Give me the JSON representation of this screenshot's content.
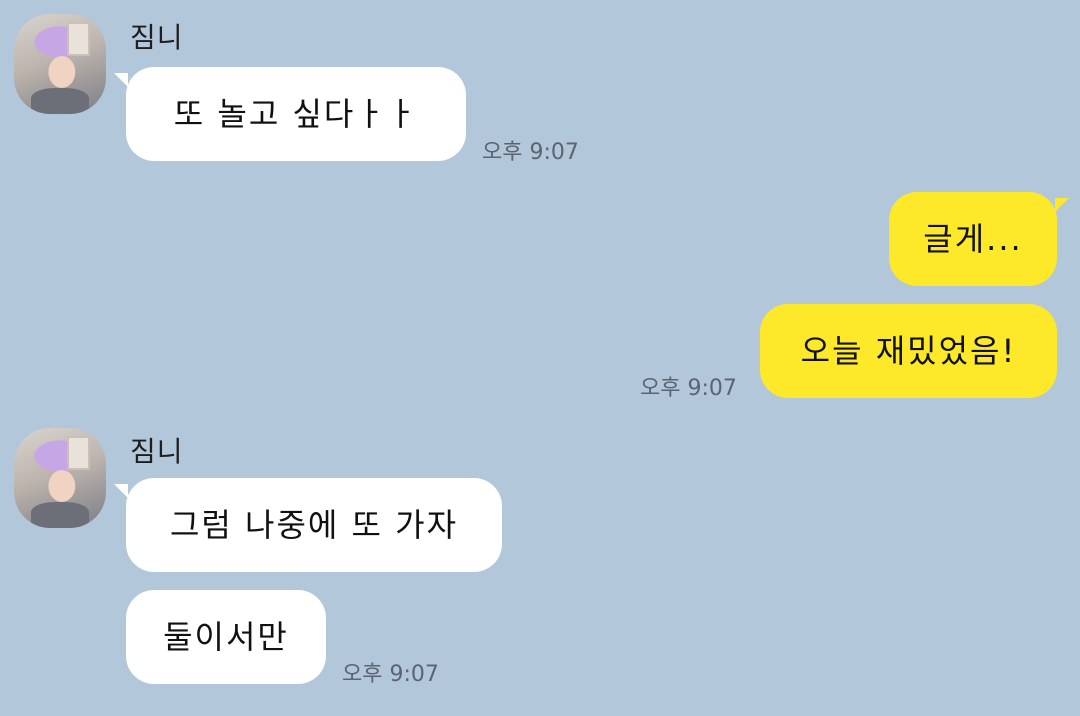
{
  "messages": [
    {
      "sender": "짐니",
      "text": "또 놀고 싶다ㅏㅏ",
      "time": "오후 9:07"
    },
    {
      "text": "글게...",
      "mine": true
    },
    {
      "text": "오늘 재밌었음!",
      "time": "오후 9:07",
      "mine": true
    },
    {
      "sender": "짐니",
      "text": "그럼 나중에 또 가자"
    },
    {
      "text": "둘이서만",
      "time": "오후 9:07"
    }
  ],
  "colors": {
    "background": "#b2c7da",
    "incoming_bubble": "#ffffff",
    "outgoing_bubble": "#fde92a"
  }
}
